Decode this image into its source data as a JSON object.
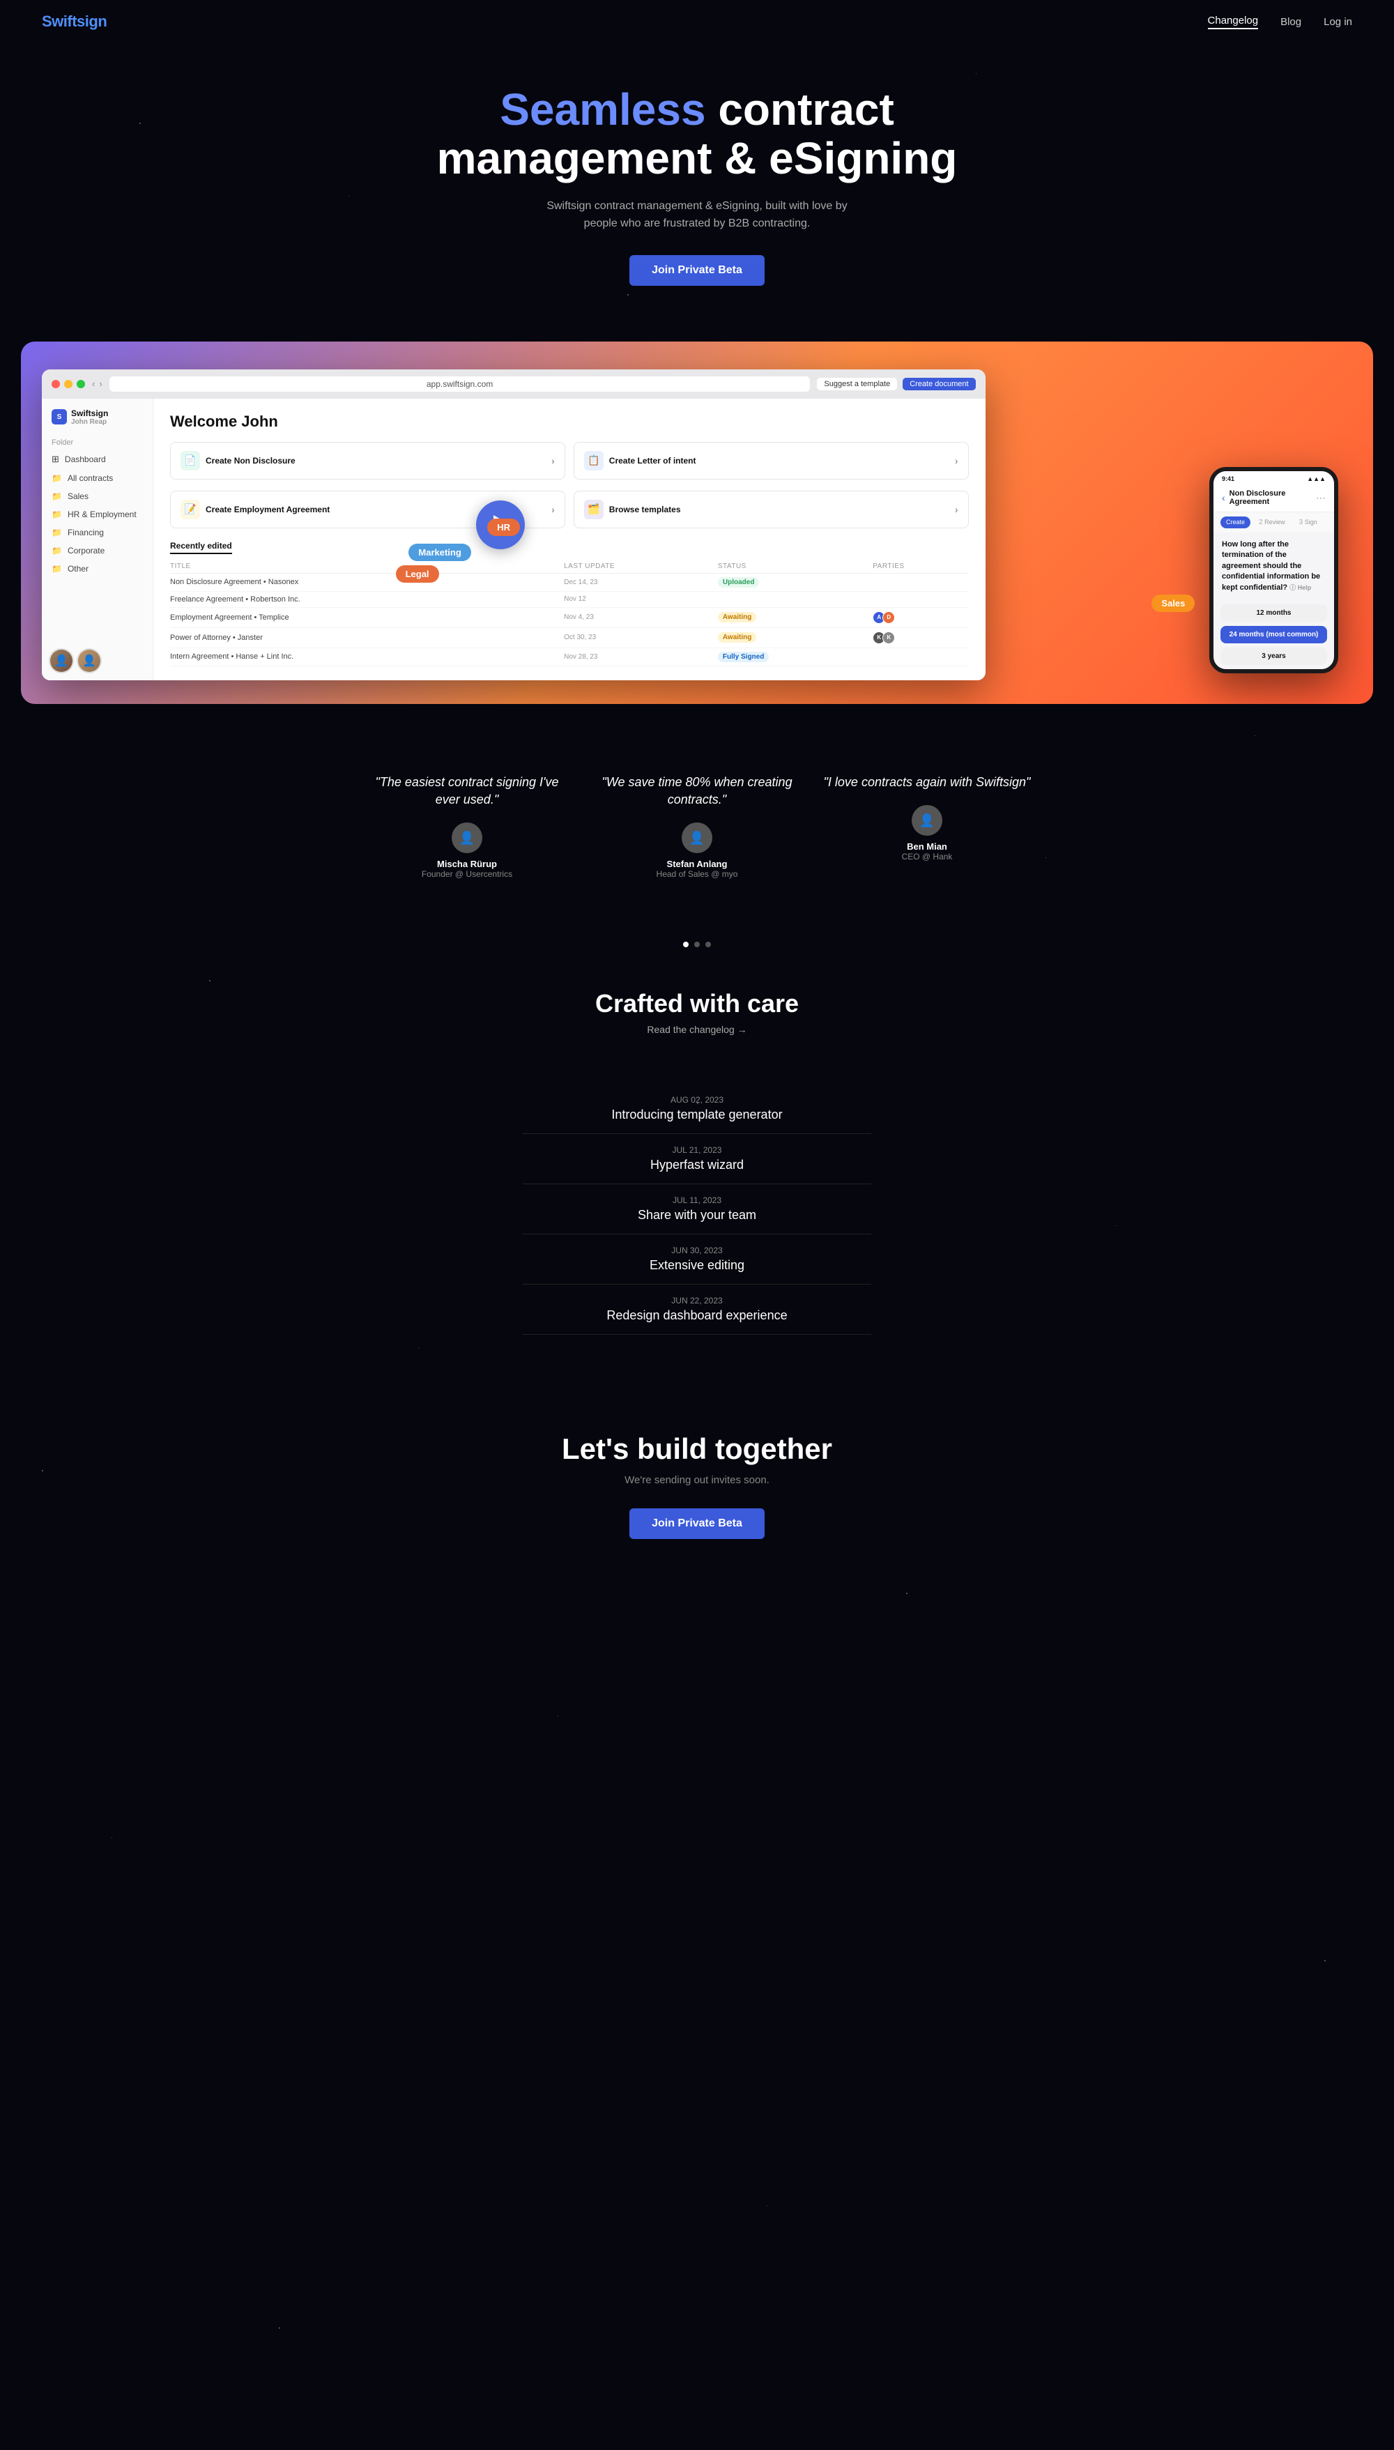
{
  "nav": {
    "logo": "Swiftsign",
    "links": [
      {
        "label": "Changelog",
        "active": true
      },
      {
        "label": "Blog",
        "active": false
      },
      {
        "label": "Log in",
        "active": false
      }
    ]
  },
  "hero": {
    "title_highlight": "Seamless",
    "title_rest": " contract\nmanagement & eSigning",
    "subtitle": "Swiftsign contract management & eSigning, built with love by people who are frustrated by B2B contracting.",
    "cta_button": "Join Private Beta"
  },
  "browser": {
    "url": "app.swiftsign.com",
    "suggest_label": "Suggest a template",
    "create_label": "Create document"
  },
  "app": {
    "sidebar": {
      "brand": "Swiftsign",
      "user": "John Reap",
      "folder_label": "Folder",
      "items": [
        {
          "label": "Dashboard",
          "active": true
        },
        {
          "label": "All contracts"
        },
        {
          "label": "Sales"
        },
        {
          "label": "HR & Employment"
        },
        {
          "label": "Financing"
        },
        {
          "label": "Corporate"
        },
        {
          "label": "Other"
        }
      ]
    },
    "welcome": "Welcome John",
    "action_cards": [
      {
        "label": "Create Non Disclosure",
        "color": "green"
      },
      {
        "label": "Create Letter of intent",
        "color": "blue"
      },
      {
        "label": "Create Employment Agreement",
        "color": "yellow"
      },
      {
        "label": "Browse templates",
        "color": "purple"
      }
    ],
    "recently_edited_label": "Recently edited",
    "table_headers": [
      "Title",
      "Last Update",
      "Status",
      "Parties"
    ],
    "table_rows": [
      {
        "title": "Non Disclosure Agreement • Nasonex",
        "date": "Dec 14, 23",
        "status": "Uploaded",
        "status_type": "uploaded"
      },
      {
        "title": "Freelance Agreement • Robertson Inc.",
        "date": "Nov 12",
        "status": "",
        "status_type": ""
      },
      {
        "title": "Employment Agreement • Templice",
        "date": "Nov 4, 23",
        "status": "Awaiting",
        "status_type": "awaiting"
      },
      {
        "title": "Power of Attorney • Janster",
        "date": "Oct 30, 23",
        "status": "Awaiting",
        "status_type": "awaiting"
      },
      {
        "title": "Intern Agreement • Hanse + Lint Inc.",
        "date": "Nov 28, 23",
        "status": "Fully Signed",
        "status_type": "signed"
      }
    ]
  },
  "phone": {
    "time": "9:41",
    "title": "Non Disclosure Agreement",
    "tabs": [
      "Create",
      "Review",
      "Sign"
    ],
    "question": "How long after the termination of the agreement should the confidential information be kept confidential?",
    "help_label": "Help",
    "options": [
      {
        "label": "12 months",
        "highlighted": false
      },
      {
        "label": "24 months (most common)",
        "highlighted": true
      },
      {
        "label": "3 years",
        "highlighted": false
      }
    ]
  },
  "float_labels": [
    {
      "label": "HR",
      "class": "fl-hr"
    },
    {
      "label": "Marketing",
      "class": "fl-marketing"
    },
    {
      "label": "Legal",
      "class": "fl-legal"
    },
    {
      "label": "Sales",
      "class": "fl-sales"
    }
  ],
  "testimonials": [
    {
      "quote": "\"The easiest contract signing I've ever used.\"",
      "name": "Mischa Rürup",
      "role": "Founder @ Usercentrics"
    },
    {
      "quote": "\"We save time 80% when creating contracts.\"",
      "name": "Stefan Anlang",
      "role": "Head of Sales @ myo"
    },
    {
      "quote": "\"I love contracts again with Swiftsign\"",
      "name": "Ben Mian",
      "role": "CEO @ Hank"
    }
  ],
  "changelog": {
    "section_title": "Crafted with care",
    "section_link": "Read the changelog →",
    "items": [
      {
        "date": "AUG 02, 2023",
        "text": "Introducing template generator"
      },
      {
        "date": "JUL 21, 2023",
        "text": "Hyperfast wizard"
      },
      {
        "date": "JUL 11, 2023",
        "text": "Share with your team"
      },
      {
        "date": "JUN 30, 2023",
        "text": "Extensive editing"
      },
      {
        "date": "JUN 22, 2023",
        "text": "Redesign dashboard experience"
      }
    ]
  },
  "cta": {
    "title": "Let's build together",
    "subtitle": "We're sending out invites soon.",
    "button": "Join Private Beta"
  }
}
